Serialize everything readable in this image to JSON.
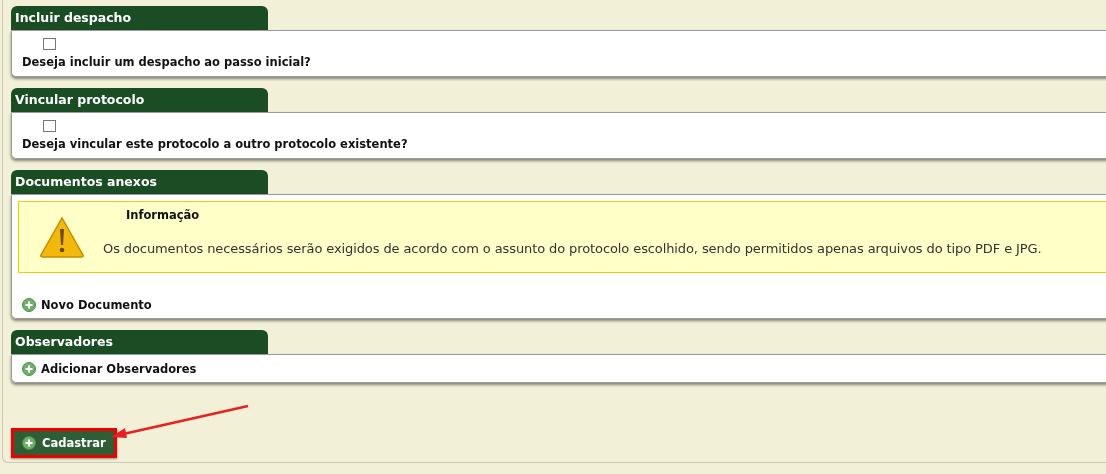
{
  "sections": [
    {
      "kind": "checkbox",
      "title": "Incluir despacho",
      "checked": false,
      "question": "Deseja incluir um despacho ao passo inicial?"
    },
    {
      "kind": "checkbox",
      "title": "Vincular protocolo",
      "checked": false,
      "question": "Deseja vincular este protocolo a outro protocolo existente?"
    },
    {
      "kind": "info",
      "title": "Documentos anexos",
      "alert": {
        "title": "Informação",
        "message": "Os documentos necessários serão exigidos de acordo com o assunto do protocolo escolhido, sendo permitidos apenas arquivos do tipo PDF e JPG."
      },
      "link": "Novo Documento"
    },
    {
      "kind": "links",
      "title": "Observadores",
      "link": "Adicionar Observadores"
    }
  ],
  "submit": {
    "label": "Cadastrar",
    "highlighted": true
  }
}
